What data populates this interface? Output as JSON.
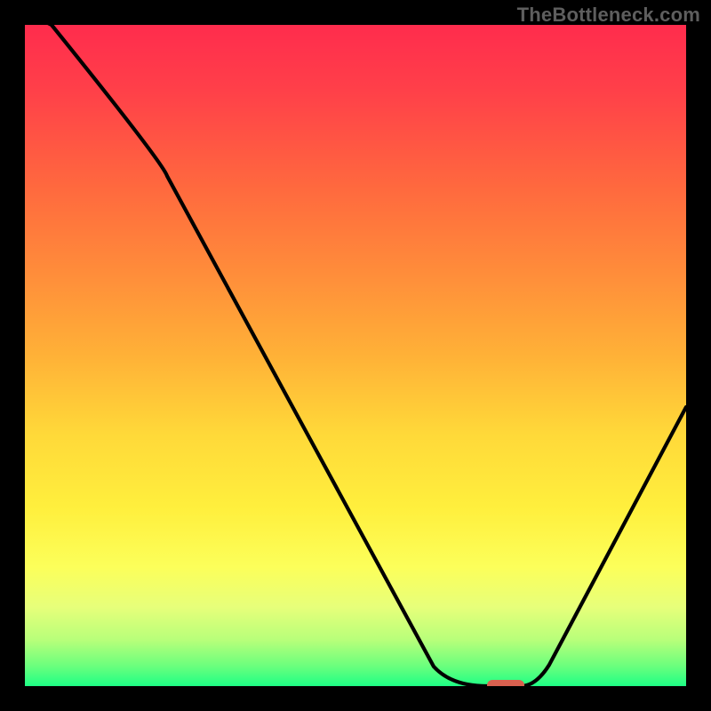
{
  "watermark": "TheBottleneck.com",
  "chart_data": {
    "type": "line",
    "title": "",
    "xlabel": "",
    "ylabel": "",
    "xlim": [
      0,
      100
    ],
    "ylim": [
      0,
      100
    ],
    "x": [
      0,
      4,
      20,
      62,
      70,
      75,
      100
    ],
    "values": [
      102,
      100,
      78,
      3,
      0,
      0,
      42
    ],
    "minimum_marker": {
      "x_start": 70,
      "x_end": 75,
      "y": 0,
      "color": "#d9604f"
    },
    "background_gradient": [
      "#ff2c4d",
      "#ffd939",
      "#1eff85"
    ],
    "note": "Values read off plot by relative position; no numeric axes are shown in the image."
  }
}
